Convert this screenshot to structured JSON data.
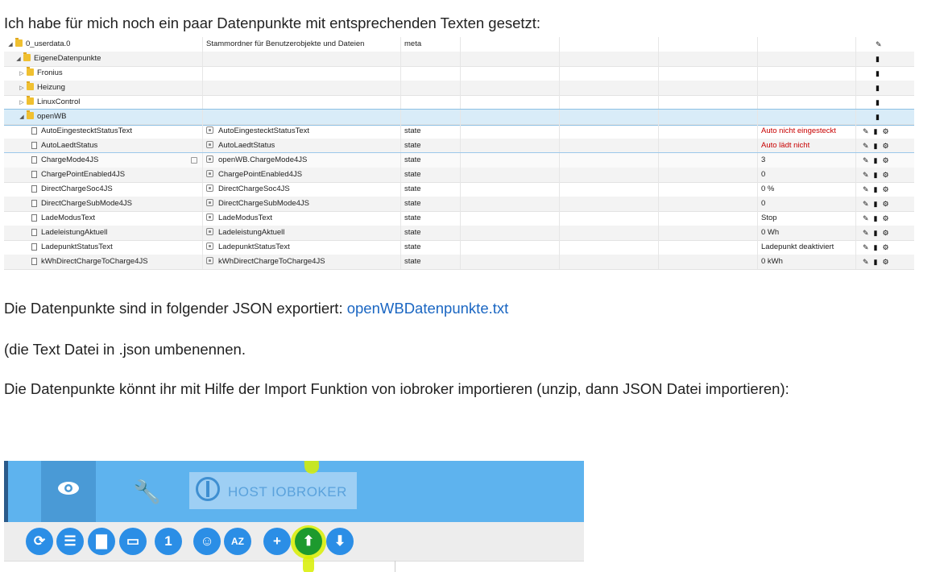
{
  "intro_text": "Ich habe für mich noch ein paar Datenpunkte mit entsprechenden Texten gesetzt:",
  "tree": {
    "rows": [
      {
        "level": 0,
        "kind": "folder",
        "expand": "down",
        "name": "0_userdata.0",
        "desc": "Stammordner für Benutzerobjekte und Dateien",
        "type": "meta",
        "value": "",
        "actions": [
          "edit"
        ]
      },
      {
        "level": 1,
        "kind": "folder",
        "expand": "down",
        "name": "EigeneDatenpunkte",
        "desc": "",
        "type": "",
        "value": "",
        "actions": [
          "delete"
        ]
      },
      {
        "level": 2,
        "kind": "folder",
        "expand": "right",
        "name": "Fronius",
        "desc": "",
        "type": "",
        "value": "",
        "actions": [
          "delete"
        ]
      },
      {
        "level": 2,
        "kind": "folder",
        "expand": "right",
        "name": "Heizung",
        "desc": "",
        "type": "",
        "value": "",
        "actions": [
          "delete"
        ]
      },
      {
        "level": 2,
        "kind": "folder",
        "expand": "right",
        "name": "LinuxControl",
        "desc": "",
        "type": "",
        "value": "",
        "actions": [
          "delete"
        ]
      },
      {
        "level": 2,
        "kind": "folder",
        "expand": "down",
        "name": "openWB",
        "desc": "",
        "type": "",
        "value": "",
        "actions": [
          "delete"
        ],
        "selected": true
      },
      {
        "level": 3,
        "kind": "state",
        "name": "AutoEingestecktStatusText",
        "desc": "AutoEingestecktStatusText",
        "type": "state",
        "value": "Auto nicht eingesteckt",
        "red": true,
        "actions": [
          "edit",
          "delete",
          "settings"
        ]
      },
      {
        "level": 3,
        "kind": "state",
        "name": "AutoLaedtStatus",
        "desc": "AutoLaedtStatus",
        "type": "state",
        "value": "Auto lädt nicht",
        "red": true,
        "actions": [
          "edit",
          "delete",
          "settings"
        ]
      },
      {
        "level": 3,
        "kind": "state",
        "name": "ChargeMode4JS",
        "desc": "openWB.ChargeMode4JS",
        "type": "state",
        "value": "3",
        "actions": [
          "edit",
          "delete",
          "settings"
        ],
        "hover": true
      },
      {
        "level": 3,
        "kind": "state",
        "name": "ChargePointEnabled4JS",
        "desc": "ChargePointEnabled4JS",
        "type": "state",
        "value": "0",
        "actions": [
          "edit",
          "delete",
          "settings"
        ]
      },
      {
        "level": 3,
        "kind": "state",
        "name": "DirectChargeSoc4JS",
        "desc": "DirectChargeSoc4JS",
        "type": "state",
        "value": "0 %",
        "actions": [
          "edit",
          "delete",
          "settings"
        ]
      },
      {
        "level": 3,
        "kind": "state",
        "name": "DirectChargeSubMode4JS",
        "desc": "DirectChargeSubMode4JS",
        "type": "state",
        "value": "0",
        "actions": [
          "edit",
          "delete",
          "settings"
        ]
      },
      {
        "level": 3,
        "kind": "state",
        "name": "LadeModusText",
        "desc": "LadeModusText",
        "type": "state",
        "value": "Stop",
        "actions": [
          "edit",
          "delete",
          "settings"
        ]
      },
      {
        "level": 3,
        "kind": "state",
        "name": "LadeleistungAktuell",
        "desc": "LadeleistungAktuell",
        "type": "state",
        "value": "0 Wh",
        "actions": [
          "edit",
          "delete",
          "settings"
        ]
      },
      {
        "level": 3,
        "kind": "state",
        "name": "LadepunktStatusText",
        "desc": "LadepunktStatusText",
        "type": "state",
        "value": "Ladepunkt deaktiviert",
        "actions": [
          "edit",
          "delete",
          "settings"
        ]
      },
      {
        "level": 3,
        "kind": "state",
        "name": "kWhDirectChargeToCharge4JS",
        "desc": "kWhDirectChargeToCharge4JS",
        "type": "state",
        "value": "0 kWh",
        "actions": [
          "edit",
          "delete",
          "settings"
        ]
      }
    ]
  },
  "export_text": "Die Datenpunkte sind in folgender JSON exportiert: ",
  "export_link": "openWBDatenpunkte.txt",
  "rename_text": "(die Text Datei in .json umbenennen.",
  "import_text": "Die Datenpunkte könnt ihr mit Hilfe der Import Funktion von iobroker importieren (unzip, dann JSON Datei importieren):",
  "toolbar": {
    "host_label": "HOST IOBROKER",
    "buttons": [
      {
        "name": "refresh-button",
        "glyph": "⟳"
      },
      {
        "name": "list-view-button",
        "glyph": "☰"
      },
      {
        "name": "folder-closed-button",
        "glyph": "▇"
      },
      {
        "name": "folder-open-button",
        "glyph": "▭"
      },
      {
        "name": "counter-button",
        "glyph": "1"
      },
      {
        "name": "expert-mode-button",
        "glyph": "☺"
      },
      {
        "name": "sort-az-button",
        "glyph": "AZ"
      },
      {
        "name": "add-object-button",
        "glyph": "+"
      },
      {
        "name": "upload-import-button",
        "glyph": "⬆"
      },
      {
        "name": "download-export-button",
        "glyph": "⬇"
      }
    ]
  },
  "colors": {
    "accent_blue": "#5eb3ee",
    "button_blue": "#2b8ee6",
    "highlight_yellow": "#d8ef00",
    "value_red": "#c80000",
    "link_blue": "#1a66c2"
  }
}
